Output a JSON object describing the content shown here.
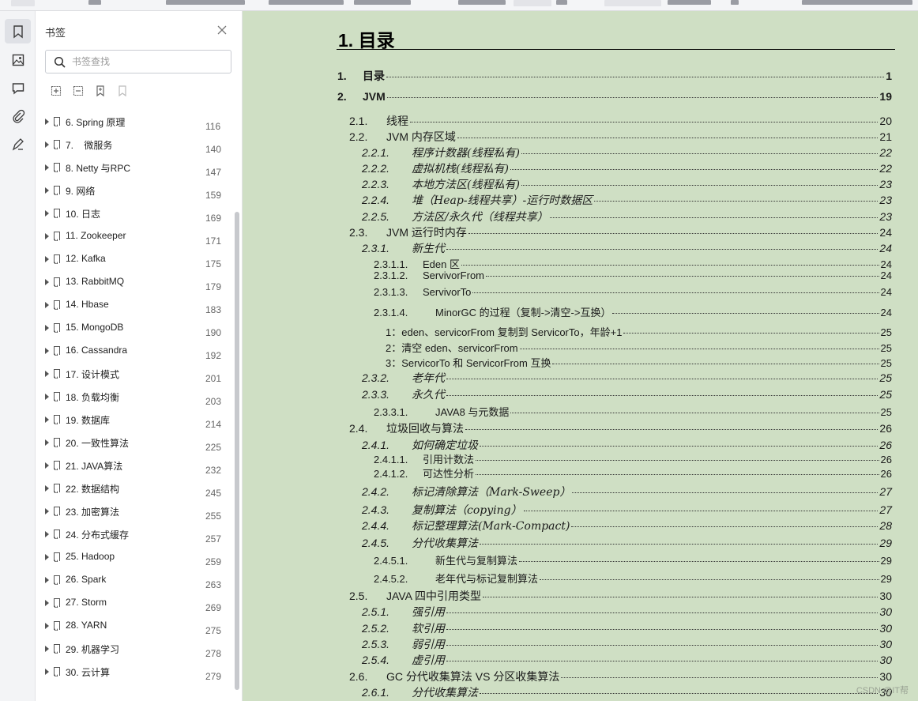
{
  "panel": {
    "title": "书签",
    "search_placeholder": "书签查找",
    "bookmarks": [
      {
        "label": "6. Spring 原理",
        "page": "116"
      },
      {
        "label": "7.    微服务",
        "page": "140"
      },
      {
        "label": "8. Netty 与RPC",
        "page": "147"
      },
      {
        "label": "9. 网络",
        "page": "159"
      },
      {
        "label": "10. 日志",
        "page": "169"
      },
      {
        "label": "11. Zookeeper",
        "page": "171"
      },
      {
        "label": "12. Kafka",
        "page": "175"
      },
      {
        "label": "13. RabbitMQ",
        "page": "179"
      },
      {
        "label": "14. Hbase",
        "page": "183"
      },
      {
        "label": "15. MongoDB",
        "page": "190"
      },
      {
        "label": "16. Cassandra",
        "page": "192"
      },
      {
        "label": "17. 设计模式",
        "page": "201"
      },
      {
        "label": "18. 负载均衡",
        "page": "203"
      },
      {
        "label": "19. 数据库",
        "page": "214"
      },
      {
        "label": "20. 一致性算法",
        "page": "225"
      },
      {
        "label": "21. JAVA算法",
        "page": "232"
      },
      {
        "label": "22. 数据结构",
        "page": "245"
      },
      {
        "label": "23. 加密算法",
        "page": "255"
      },
      {
        "label": "24. 分布式缓存",
        "page": "257"
      },
      {
        "label": "25. Hadoop",
        "page": "259"
      },
      {
        "label": "26. Spark",
        "page": "263"
      },
      {
        "label": "27. Storm",
        "page": "269"
      },
      {
        "label": "28. YARN",
        "page": "275"
      },
      {
        "label": "29. 机器学习",
        "page": "278"
      },
      {
        "label": "30. 云计算",
        "page": "279"
      }
    ]
  },
  "document": {
    "heading": "1. 目录",
    "toc": [
      {
        "level": 1,
        "num": "1.",
        "text": "目录",
        "page": "1"
      },
      {
        "level": 1,
        "num": "2.",
        "text": "JVM",
        "page": "19"
      },
      {
        "level": 2,
        "num": "2.1.",
        "text": "线程",
        "page": "20"
      },
      {
        "level": 2,
        "num": "2.2.",
        "text": "JVM 内存区域",
        "page": "21"
      },
      {
        "level": 3,
        "num": "2.2.1.",
        "text": "程序计数器(线程私有)",
        "page": "22"
      },
      {
        "level": 3,
        "num": "2.2.2.",
        "text": "虚拟机栈(线程私有)",
        "page": "22"
      },
      {
        "level": 3,
        "num": "2.2.3.",
        "text": "本地方法区(线程私有)",
        "page": "23"
      },
      {
        "level": 3,
        "num": "2.2.4.",
        "text": "堆（Heap-线程共享）-运行时数据区",
        "page": "23"
      },
      {
        "level": 3,
        "num": "2.2.5.",
        "text": "方法区/永久代（线程共享）",
        "page": "23"
      },
      {
        "level": 2,
        "num": "2.3.",
        "text": "JVM 运行时内存",
        "page": "24"
      },
      {
        "level": 3,
        "num": "2.3.1.",
        "text": "新生代",
        "page": "24"
      },
      {
        "level": 4,
        "num": "2.3.1.1.",
        "text": "Eden 区",
        "page": "24"
      },
      {
        "level": 4,
        "num": "2.3.1.2.",
        "text": "ServivorFrom",
        "page": "24"
      },
      {
        "level": 4,
        "num": "2.3.1.3.",
        "text": "ServivorTo",
        "page": "24"
      },
      {
        "level": 4,
        "num": "2.3.1.4.",
        "text": "MinorGC 的过程（复制->清空->互换）",
        "page": "24"
      },
      {
        "level": 5,
        "num": "",
        "text": "1：eden、servicorFrom 复制到 ServicorTo，年龄+1",
        "page": "25"
      },
      {
        "level": 5,
        "num": "",
        "text": "2：清空 eden、servicorFrom",
        "page": "25"
      },
      {
        "level": 5,
        "num": "",
        "text": "3：ServicorTo 和 ServicorFrom 互换",
        "page": "25"
      },
      {
        "level": 3,
        "num": "2.3.2.",
        "text": "老年代",
        "page": "25"
      },
      {
        "level": 3,
        "num": "2.3.3.",
        "text": "永久代",
        "page": "25"
      },
      {
        "level": 4,
        "num": "2.3.3.1.",
        "text": "JAVA8 与元数据",
        "page": "25"
      },
      {
        "level": 2,
        "num": "2.4.",
        "text": "垃圾回收与算法",
        "page": "26"
      },
      {
        "level": 3,
        "num": "2.4.1.",
        "text": "如何确定垃圾",
        "page": "26"
      },
      {
        "level": 4,
        "num": "2.4.1.1.",
        "text": "引用计数法",
        "page": "26"
      },
      {
        "level": 4,
        "num": "2.4.1.2.",
        "text": "可达性分析",
        "page": "26"
      },
      {
        "level": 3,
        "num": "2.4.2.",
        "text": "标记清除算法（Mark-Sweep）",
        "page": "27"
      },
      {
        "level": 3,
        "num": "2.4.3.",
        "text": "复制算法（copying）",
        "page": "27"
      },
      {
        "level": 3,
        "num": "2.4.4.",
        "text": "标记整理算法(Mark-Compact)",
        "page": "28"
      },
      {
        "level": 3,
        "num": "2.4.5.",
        "text": "分代收集算法",
        "page": "29"
      },
      {
        "level": 4,
        "num": "2.4.5.1.",
        "text": "新生代与复制算法",
        "page": "29"
      },
      {
        "level": 4,
        "num": "2.4.5.2.",
        "text": "老年代与标记复制算法",
        "page": "29"
      },
      {
        "level": 2,
        "num": "2.5.",
        "text": "JAVA 四中引用类型",
        "page": "30"
      },
      {
        "level": 3,
        "num": "2.5.1.",
        "text": "强引用",
        "page": "30"
      },
      {
        "level": 3,
        "num": "2.5.2.",
        "text": "软引用",
        "page": "30"
      },
      {
        "level": 3,
        "num": "2.5.3.",
        "text": "弱引用",
        "page": "30"
      },
      {
        "level": 3,
        "num": "2.5.4.",
        "text": "虚引用",
        "page": "30"
      },
      {
        "level": 2,
        "num": "2.6.",
        "text": "GC 分代收集算法 VS 分区收集算法",
        "page": "30"
      },
      {
        "level": 3,
        "num": "2.6.1.",
        "text": "分代收集算法",
        "page": "30"
      }
    ],
    "watermark": "CSDN @IT帮"
  },
  "colors": {
    "page_background": "#cfdfc4",
    "panel_background": "#ffffff",
    "rail_background": "#f3f4f6"
  }
}
